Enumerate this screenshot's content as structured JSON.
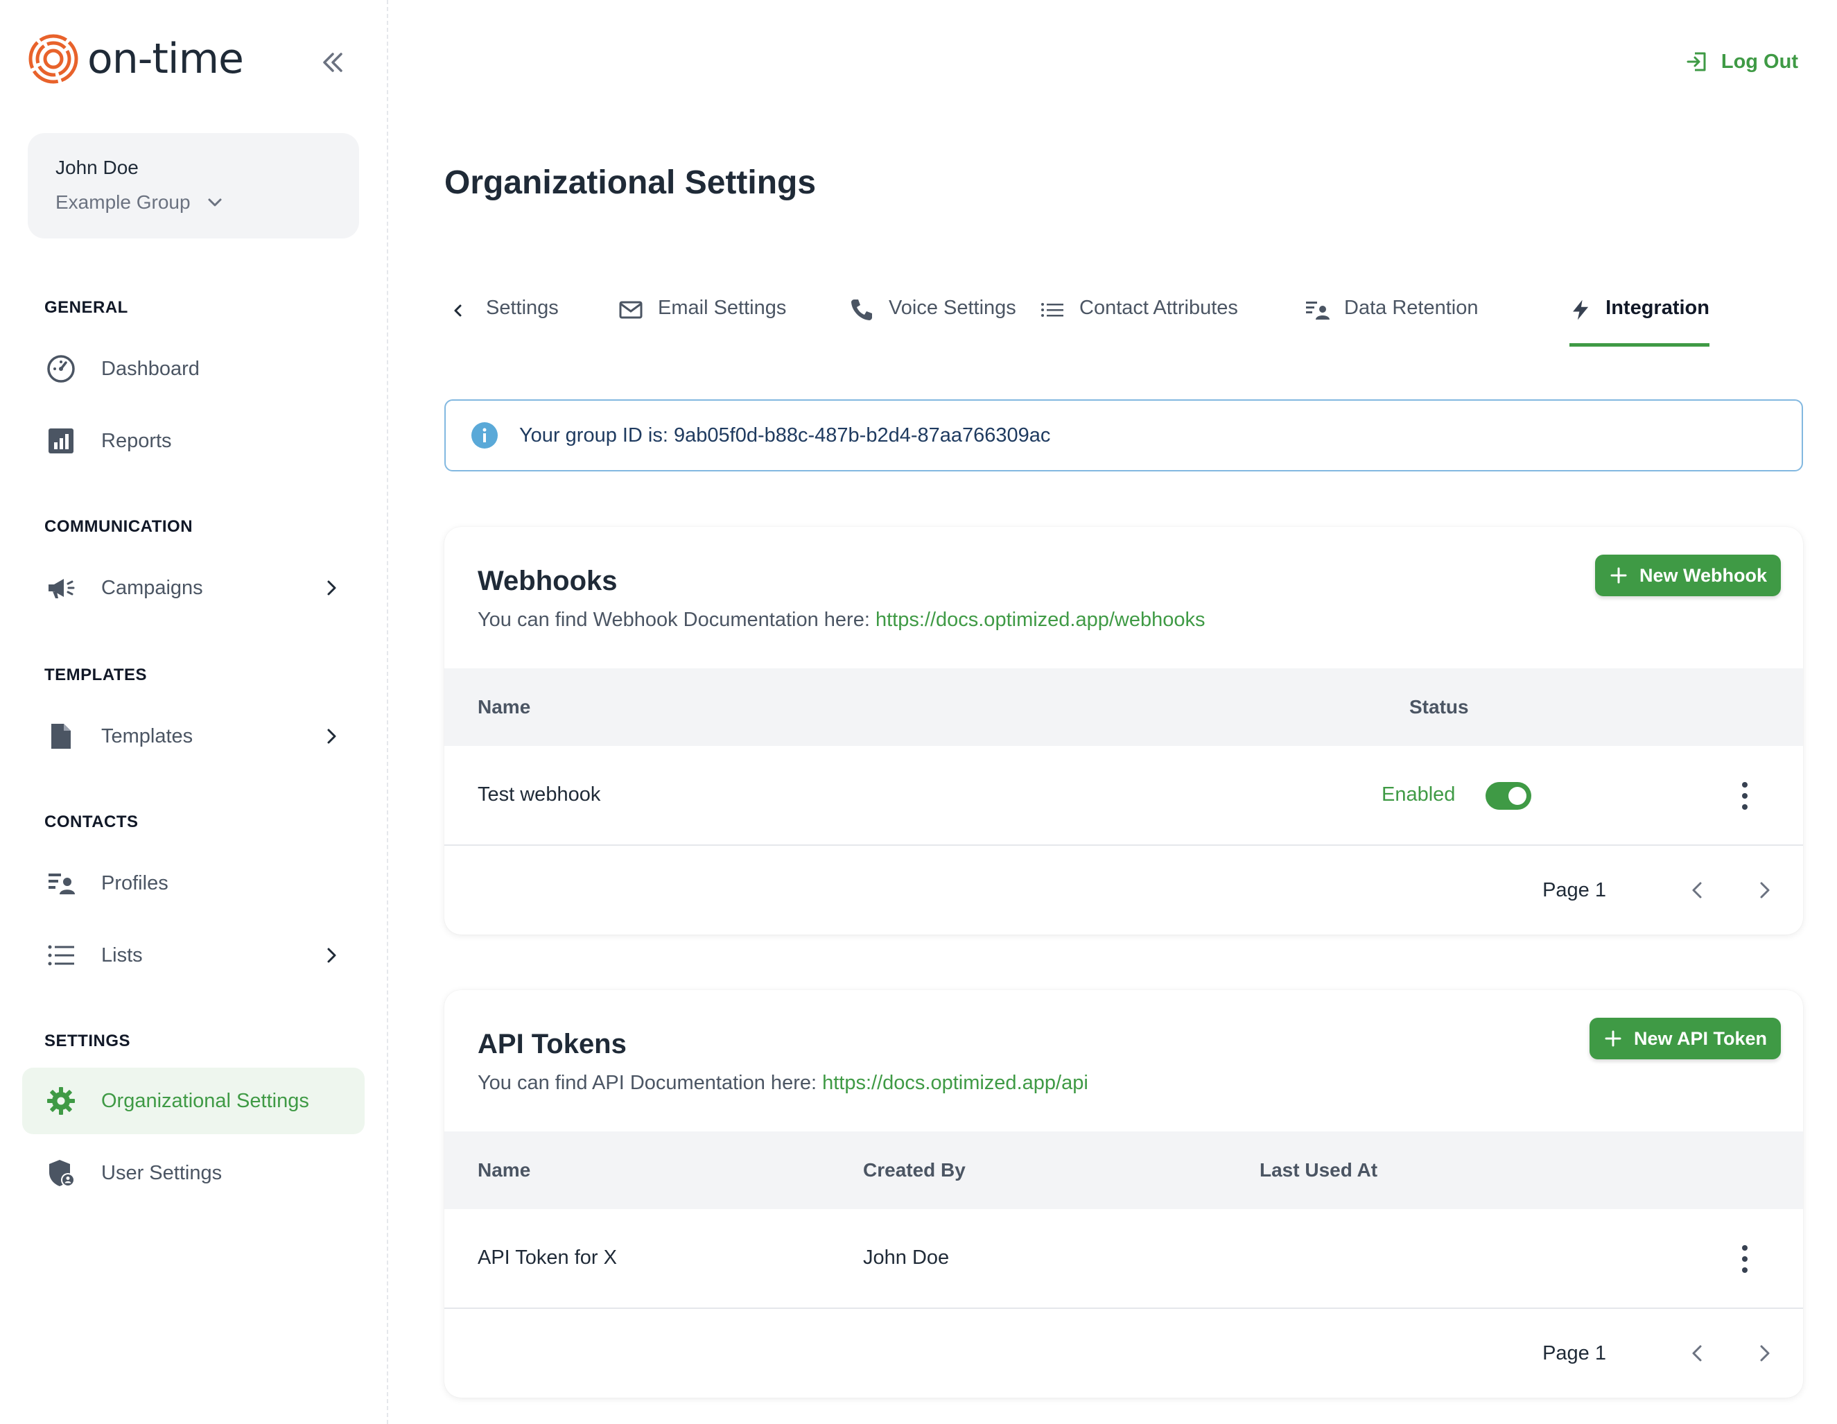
{
  "brand": {
    "name": "on-time",
    "accent": "#3f9a45",
    "logo_color": "#e8622b"
  },
  "user": {
    "name": "John Doe",
    "group": "Example Group"
  },
  "sidebar": {
    "sections": [
      {
        "title": "GENERAL",
        "items": [
          {
            "label": "Dashboard",
            "icon": "gauge-icon"
          },
          {
            "label": "Reports",
            "icon": "chart-icon"
          }
        ]
      },
      {
        "title": "COMMUNICATION",
        "items": [
          {
            "label": "Campaigns",
            "icon": "megaphone-icon"
          }
        ]
      },
      {
        "title": "TEMPLATES",
        "items": [
          {
            "label": "Templates",
            "icon": "document-icon"
          }
        ]
      },
      {
        "title": "CONTACTS",
        "items": [
          {
            "label": "Profiles",
            "icon": "profiles-icon"
          },
          {
            "label": "Lists",
            "icon": "list-icon"
          }
        ]
      },
      {
        "title": "SETTINGS",
        "items": [
          {
            "label": "Organizational Settings",
            "icon": "gear-icon",
            "active": true
          },
          {
            "label": "User Settings",
            "icon": "shield-user-icon"
          }
        ]
      }
    ]
  },
  "header": {
    "logout_label": "Log Out"
  },
  "page": {
    "title": "Organizational Settings"
  },
  "tabs": [
    {
      "label": "Settings",
      "icon": "chevron-left-icon"
    },
    {
      "label": "Email Settings",
      "icon": "mail-icon"
    },
    {
      "label": "Voice Settings",
      "icon": "phone-icon"
    },
    {
      "label": "Contact Attributes",
      "icon": "list-icon"
    },
    {
      "label": "Data Retention",
      "icon": "profiles-icon"
    },
    {
      "label": "Integration",
      "icon": "lightning-icon",
      "active": true
    }
  ],
  "info": {
    "text": "Your group ID is: 9ab05f0d-b88c-487b-b2d4-87aa766309ac"
  },
  "webhooks": {
    "title": "Webhooks",
    "subtitle": "You can find Webhook Documentation here: ",
    "link": "https://docs.optimized.app/webhooks",
    "button": "New Webhook",
    "columns": {
      "name": "Name",
      "status": "Status"
    },
    "rows": [
      {
        "name": "Test webhook",
        "status": "Enabled",
        "enabled": true
      }
    ],
    "page_label": "Page 1"
  },
  "api_tokens": {
    "title": "API Tokens",
    "subtitle": "You can find API Documentation here: ",
    "link": "https://docs.optimized.app/api",
    "button": "New API Token",
    "columns": {
      "name": "Name",
      "created_by": "Created By",
      "last_used": "Last Used At"
    },
    "rows": [
      {
        "name": "API Token for X",
        "created_by": "John Doe",
        "last_used": ""
      }
    ],
    "page_label": "Page 1"
  }
}
